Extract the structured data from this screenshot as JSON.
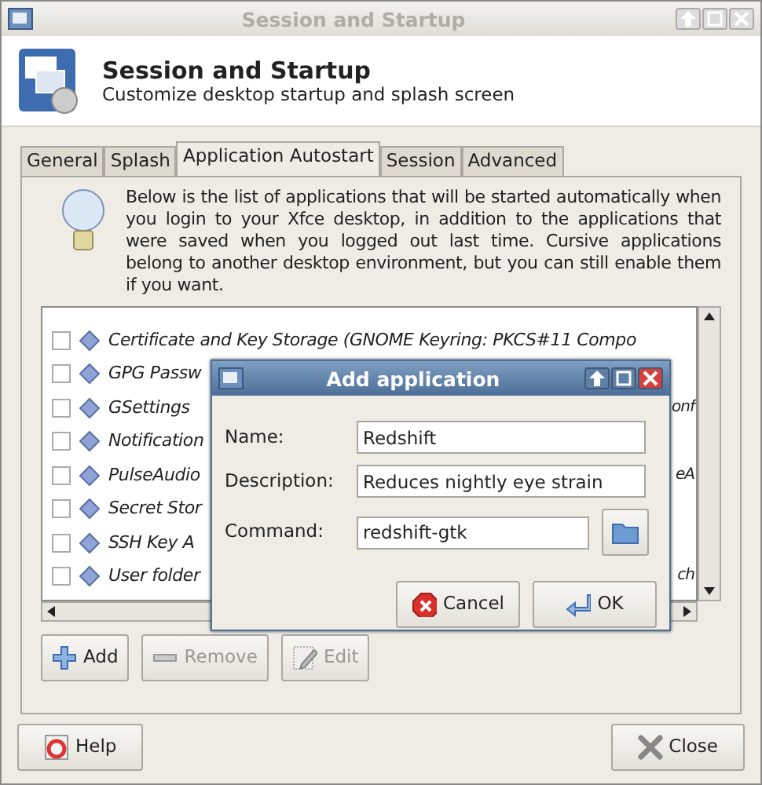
{
  "window": {
    "title": "Session and Startup",
    "active": false
  },
  "header": {
    "title": "Session and Startup",
    "subtitle": "Customize desktop startup and splash screen"
  },
  "tabs": [
    {
      "label": "General",
      "selected": false
    },
    {
      "label": "Splash",
      "selected": false
    },
    {
      "label": "Application Autostart",
      "selected": true
    },
    {
      "label": "Session",
      "selected": false
    },
    {
      "label": "Advanced",
      "selected": false
    }
  ],
  "info": "Below is the list of applications that will be started automatically when you login to your Xfce desktop, in addition to the applications that were saved when you logged out last time. Cursive applications belong to another desktop environment, but you can still enable them if you want.",
  "autostart": [
    {
      "label": "Certificate and Key Storage (GNOME Keyring: PKCS#11 Compo",
      "checked": false
    },
    {
      "label": "GPG Passw",
      "checked": false
    },
    {
      "label": "GSettings",
      "tail": "onf",
      "checked": false
    },
    {
      "label": "Notification",
      "checked": false
    },
    {
      "label": "PulseAudio",
      "tail": "eA",
      "checked": false
    },
    {
      "label": "Secret Stor",
      "checked": false
    },
    {
      "label": "SSH Key A",
      "checked": false
    },
    {
      "label": "User folder",
      "tail": "ch",
      "checked": false
    }
  ],
  "list_buttons": [
    {
      "label": "Add",
      "disabled": false,
      "kind": "add"
    },
    {
      "label": "Remove",
      "disabled": true,
      "kind": "remove"
    },
    {
      "label": "Edit",
      "disabled": true,
      "kind": "edit"
    }
  ],
  "footer_buttons": [
    {
      "label": "Help",
      "kind": "help"
    },
    {
      "label": "Close",
      "kind": "close"
    }
  ],
  "dialog": {
    "title": "Add application",
    "active": true,
    "fields": [
      {
        "label": "Name:",
        "value": "Redshift",
        "kind": "text"
      },
      {
        "label": "Description:",
        "value": "Reduces nightly eye strain",
        "kind": "text"
      },
      {
        "label": "Command:",
        "value": "redshift-gtk",
        "kind": "file"
      }
    ],
    "buttons": [
      {
        "label": "Cancel",
        "kind": "cancel"
      },
      {
        "label": "OK",
        "kind": "ok"
      }
    ]
  }
}
